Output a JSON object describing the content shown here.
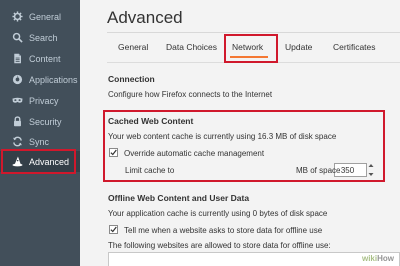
{
  "sidebar": {
    "items": [
      {
        "label": "General",
        "icon": "gear-icon"
      },
      {
        "label": "Search",
        "icon": "search-icon"
      },
      {
        "label": "Content",
        "icon": "document-icon"
      },
      {
        "label": "Applications",
        "icon": "applications-icon"
      },
      {
        "label": "Privacy",
        "icon": "mask-icon"
      },
      {
        "label": "Security",
        "icon": "lock-icon"
      },
      {
        "label": "Sync",
        "icon": "sync-icon"
      },
      {
        "label": "Advanced",
        "icon": "wizard-hat-icon"
      }
    ],
    "active_item": "Advanced"
  },
  "page": {
    "title": "Advanced"
  },
  "tabs": {
    "items": [
      "General",
      "Data Choices",
      "Network",
      "Update",
      "Certificates"
    ],
    "selected": "Network"
  },
  "connection": {
    "heading": "Connection",
    "description": "Configure how Firefox connects to the Internet"
  },
  "cached_web_content": {
    "heading": "Cached Web Content",
    "usage_text": "Your web content cache is currently using 16.3 MB of disk space",
    "override_label": "Override automatic cache management",
    "override_checked": true,
    "limit_label": "Limit cache to",
    "limit_value": "350",
    "limit_unit": "MB of space"
  },
  "offline": {
    "heading": "Offline Web Content and User Data",
    "usage_text": "Your application cache is currently using 0 bytes of disk space",
    "tell_me_label": "Tell me when a website asks to store data for offline use",
    "tell_me_checked": true,
    "allowed_text": "The following websites are allowed to store data for offline use:"
  },
  "watermark": {
    "wiki": "wiki",
    "how": "How"
  },
  "colors": {
    "sidebar_bg": "#424f5a",
    "sidebar_text": "#c1cdd7",
    "accent_orange": "#f47833",
    "highlight_red": "#d0182c",
    "content_bg": "#f3f3f3"
  }
}
